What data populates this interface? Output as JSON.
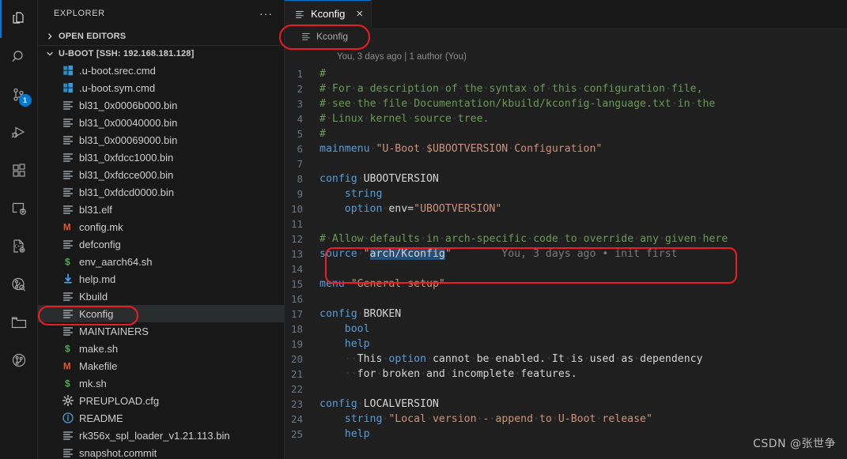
{
  "activity_bar": {
    "items": [
      {
        "name": "explorer",
        "icon": "files-icon",
        "active": true,
        "badge": null
      },
      {
        "name": "search",
        "icon": "search-icon",
        "active": false,
        "badge": null
      },
      {
        "name": "source-control",
        "icon": "source-control-icon",
        "active": false,
        "badge": "1"
      },
      {
        "name": "run-and-debug",
        "icon": "run-debug-icon",
        "active": false,
        "badge": null
      },
      {
        "name": "extensions",
        "icon": "extensions-icon",
        "active": false,
        "badge": null
      },
      {
        "name": "remote-explorer",
        "icon": "remote-explorer-icon",
        "active": false,
        "badge": null
      },
      {
        "name": "cpp-config",
        "icon": "cpp-file-gear-icon",
        "active": false,
        "badge": null
      },
      {
        "name": "git-graph-search",
        "icon": "git-search-icon",
        "active": false,
        "badge": null
      },
      {
        "name": "folder-view",
        "icon": "folder-icon",
        "active": false,
        "badge": null
      },
      {
        "name": "git-graph",
        "icon": "git-branch-circle-icon",
        "active": false,
        "badge": null
      }
    ]
  },
  "sidebar": {
    "title": "EXPLORER",
    "more_actions": "···",
    "sections": [
      {
        "label": "OPEN EDITORS",
        "expanded": false
      },
      {
        "label": "U-BOOT [SSH: 192.168.181.128]",
        "expanded": true
      }
    ],
    "files": [
      {
        "name": ".u-boot.srec.cmd",
        "icon": "cmd-file-icon",
        "selected": false
      },
      {
        "name": ".u-boot.sym.cmd",
        "icon": "cmd-file-icon",
        "selected": false
      },
      {
        "name": "bl31_0x0006b000.bin",
        "icon": "text-file-icon",
        "selected": false
      },
      {
        "name": "bl31_0x00040000.bin",
        "icon": "text-file-icon",
        "selected": false
      },
      {
        "name": "bl31_0x00069000.bin",
        "icon": "text-file-icon",
        "selected": false
      },
      {
        "name": "bl31_0xfdcc1000.bin",
        "icon": "text-file-icon",
        "selected": false
      },
      {
        "name": "bl31_0xfdcce000.bin",
        "icon": "text-file-icon",
        "selected": false
      },
      {
        "name": "bl31_0xfdcd0000.bin",
        "icon": "text-file-icon",
        "selected": false
      },
      {
        "name": "bl31.elf",
        "icon": "text-file-icon",
        "selected": false
      },
      {
        "name": "config.mk",
        "icon": "makefile-icon",
        "selected": false
      },
      {
        "name": "defconfig",
        "icon": "text-file-icon",
        "selected": false
      },
      {
        "name": "env_aarch64.sh",
        "icon": "shell-file-icon",
        "selected": false
      },
      {
        "name": "help.md",
        "icon": "markdown-file-icon",
        "selected": false
      },
      {
        "name": "Kbuild",
        "icon": "text-file-icon",
        "selected": false
      },
      {
        "name": "Kconfig",
        "icon": "text-file-icon",
        "selected": true
      },
      {
        "name": "MAINTAINERS",
        "icon": "text-file-icon",
        "selected": false
      },
      {
        "name": "make.sh",
        "icon": "shell-file-icon",
        "selected": false
      },
      {
        "name": "Makefile",
        "icon": "makefile-icon",
        "selected": false
      },
      {
        "name": "mk.sh",
        "icon": "shell-file-icon",
        "selected": false
      },
      {
        "name": "PREUPLOAD.cfg",
        "icon": "config-gear-icon",
        "selected": false
      },
      {
        "name": "README",
        "icon": "info-file-icon",
        "selected": false
      },
      {
        "name": "rk356x_spl_loader_v1.21.113.bin",
        "icon": "text-file-icon",
        "selected": false
      },
      {
        "name": "snapshot.commit",
        "icon": "text-file-icon",
        "selected": false
      }
    ]
  },
  "editor": {
    "tab": {
      "label": "Kconfig",
      "icon": "text-file-icon",
      "close": "×"
    },
    "breadcrumb": {
      "label": "Kconfig",
      "icon": "text-file-icon"
    },
    "blame_header": "You, 3 days ago | 1 author (You)",
    "inline_blame_line13": "You, 3 days ago • init first",
    "selection_text": "arch/Kconfig",
    "lines": [
      {
        "n": "1",
        "text": "#"
      },
      {
        "n": "2",
        "text": "# For a description of the syntax of this configuration file,"
      },
      {
        "n": "3",
        "text": "# see the file Documentation/kbuild/kconfig-language.txt in the"
      },
      {
        "n": "4",
        "text": "# Linux kernel source tree."
      },
      {
        "n": "5",
        "text": "#"
      },
      {
        "n": "6",
        "text": "mainmenu \"U-Boot $UBOOTVERSION Configuration\""
      },
      {
        "n": "7",
        "text": ""
      },
      {
        "n": "8",
        "text": "config UBOOTVERSION"
      },
      {
        "n": "9",
        "text": "\tstring"
      },
      {
        "n": "10",
        "text": "\toption env=\"UBOOTVERSION\""
      },
      {
        "n": "11",
        "text": ""
      },
      {
        "n": "12",
        "text": "# Allow defaults in arch-specific code to override any given here"
      },
      {
        "n": "13",
        "text": "source \"arch/Kconfig\""
      },
      {
        "n": "14",
        "text": ""
      },
      {
        "n": "15",
        "text": "menu \"General setup\""
      },
      {
        "n": "16",
        "text": ""
      },
      {
        "n": "17",
        "text": "config BROKEN"
      },
      {
        "n": "18",
        "text": "\tbool"
      },
      {
        "n": "19",
        "text": "\thelp"
      },
      {
        "n": "20",
        "text": "\t  This option cannot be enabled. It is used as dependency"
      },
      {
        "n": "21",
        "text": "\t  for broken and incomplete features."
      },
      {
        "n": "22",
        "text": ""
      },
      {
        "n": "23",
        "text": "config LOCALVERSION"
      },
      {
        "n": "24",
        "text": "\tstring \"Local version - append to U-Boot release\""
      },
      {
        "n": "25",
        "text": "\thelp"
      }
    ]
  },
  "annotations": {
    "breadcrumb_highlight": "oval",
    "sidebar_kconfig_highlight": "oval",
    "code_lines_12_13_highlight": "rounded-rect"
  },
  "watermark": "CSDN @张世争",
  "colors": {
    "accent": "#0078d4",
    "annotation": "#ee1c25",
    "selection": "#264f78",
    "comment": "#6a9955",
    "keyword": "#569cd6",
    "string": "#ce9178",
    "editor_bg": "#1f1f1f",
    "sidebar_bg": "#181818"
  }
}
